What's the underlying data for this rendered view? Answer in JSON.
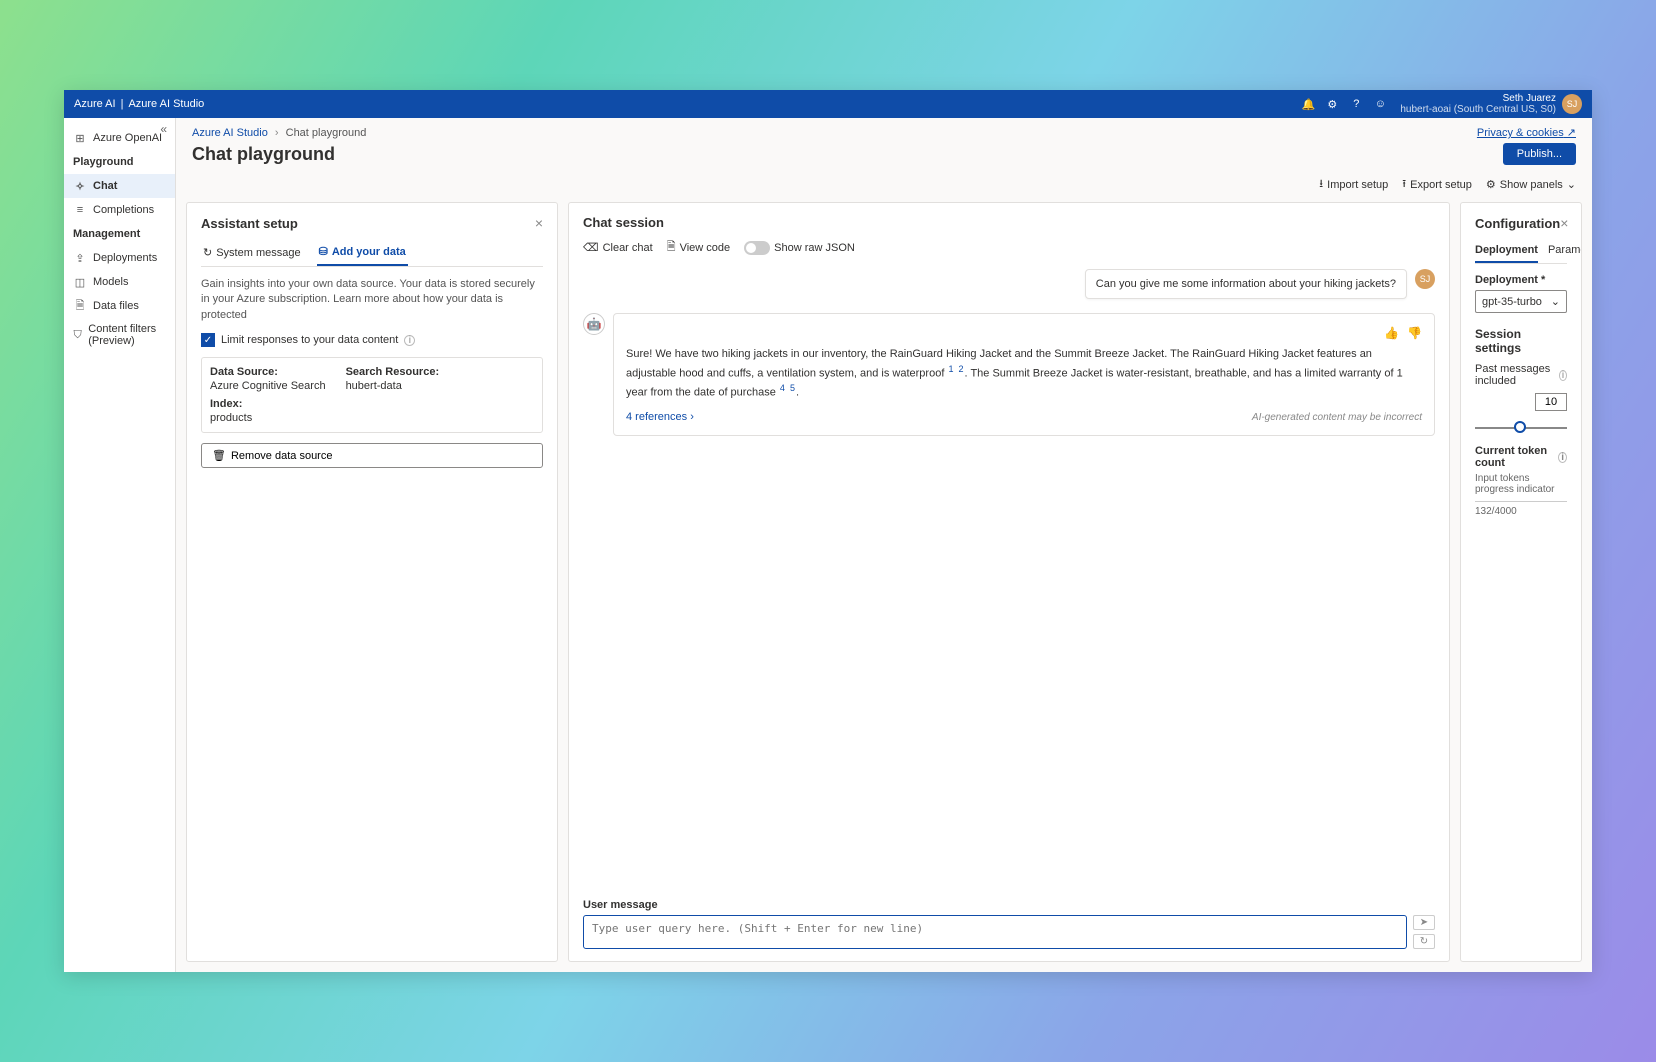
{
  "topbar": {
    "brand1": "Azure AI",
    "brand2": "Azure AI Studio",
    "user_name": "Seth Juarez",
    "user_sub": "hubert-aoai (South Central US, S0)"
  },
  "sidebar": {
    "items": [
      {
        "icon": "⊞",
        "label": "Azure OpenAI",
        "name": "azure-openai"
      }
    ],
    "section_playground": "Playground",
    "playground_items": [
      {
        "icon": "✧",
        "label": "Chat",
        "name": "chat",
        "active": true
      },
      {
        "icon": "≡",
        "label": "Completions",
        "name": "completions"
      }
    ],
    "section_management": "Management",
    "management_items": [
      {
        "icon": "⇪",
        "label": "Deployments",
        "name": "deployments"
      },
      {
        "icon": "◫",
        "label": "Models",
        "name": "models"
      },
      {
        "icon": "🗎",
        "label": "Data files",
        "name": "data-files"
      },
      {
        "icon": "⛉",
        "label": "Content filters (Preview)",
        "name": "content-filters"
      }
    ]
  },
  "breadcrumbs": {
    "root": "Azure AI Studio",
    "current": "Chat playground",
    "privacy": "Privacy & cookies"
  },
  "page": {
    "title": "Chat playground",
    "publish": "Publish...",
    "import_setup": "Import setup",
    "export_setup": "Export setup",
    "show_panels": "Show panels"
  },
  "assistant": {
    "title": "Assistant setup",
    "tab_system": "System message",
    "tab_data": "Add your data",
    "description": "Gain insights into your own data source. Your data is stored securely in your Azure subscription. Learn more about how your data is protected",
    "limit_checkbox": "Limit responses to your data content",
    "label_source": "Data Source:",
    "value_source": "Azure Cognitive Search",
    "label_search": "Search Resource:",
    "value_search": "hubert-data",
    "label_index": "Index:",
    "value_index": "products",
    "remove_btn": "Remove data source"
  },
  "chat": {
    "title": "Chat session",
    "clear": "Clear chat",
    "view_code": "View code",
    "show_json": "Show raw JSON",
    "user_msg": "Can you give me some information about your hiking jackets?",
    "bot_msg_a": "Sure! We have two hiking jackets in our inventory, the RainGuard Hiking Jacket and the Summit Breeze Jacket. The RainGuard Hiking Jacket features an adjustable hood and cuffs, a ventilation system, and is waterproof ",
    "bot_msg_b": ". The Summit Breeze Jacket is water-resistant, breathable, and has a limited warranty of 1 year from the date of purchase ",
    "bot_msg_c": ".",
    "refs": "4 references",
    "disclaimer": "AI-generated content may be incorrect",
    "input_label": "User message",
    "input_placeholder": "Type user query here. (Shift + Enter for new line)"
  },
  "config": {
    "title": "Configuration",
    "tab_deployment": "Deployment",
    "tab_parameters": "Parameters",
    "deployment_label": "Deployment *",
    "deployment_value": "gpt-35-turbo",
    "session_title": "Session settings",
    "past_msgs_label": "Past messages included",
    "past_msgs_value": "10",
    "token_title": "Current token count",
    "token_sub": "Input tokens progress indicator",
    "token_value": "132/4000"
  }
}
